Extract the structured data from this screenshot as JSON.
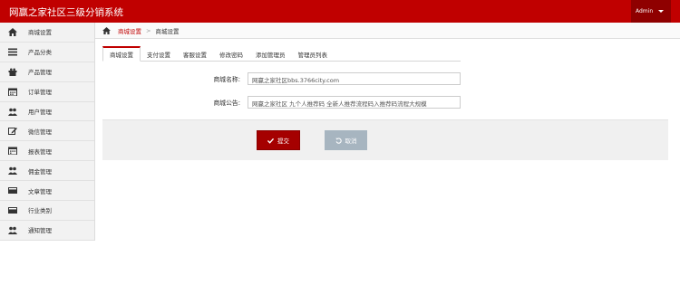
{
  "app": {
    "title": "网赢之家社区三级分销系统",
    "user": "Admin"
  },
  "sidebar": {
    "items": [
      {
        "label": "商城设置",
        "icon": "home-icon"
      },
      {
        "label": "产品分类",
        "icon": "list-icon"
      },
      {
        "label": "产品管理",
        "icon": "gift-icon"
      },
      {
        "label": "订单管理",
        "icon": "calendar-icon"
      },
      {
        "label": "用户管理",
        "icon": "users-icon"
      },
      {
        "label": "微信管理",
        "icon": "edit-icon"
      },
      {
        "label": "报表管理",
        "icon": "calendar-icon"
      },
      {
        "label": "佣金管理",
        "icon": "users-icon"
      },
      {
        "label": "文章管理",
        "icon": "card-icon"
      },
      {
        "label": "行业类别",
        "icon": "card-icon"
      },
      {
        "label": "通知管理",
        "icon": "users-icon"
      }
    ]
  },
  "breadcrumb": {
    "parent": "商城设置",
    "current": "商城设置"
  },
  "tabs": [
    "商城设置",
    "支付设置",
    "客服设置",
    "修改密码",
    "添加管理员",
    "管理员列表"
  ],
  "form": {
    "name_label": "商城名称:",
    "name_value": "网赢之家社区bbs.3766city.com",
    "notice_label": "商城公告:",
    "notice_value": "网赢之家社区 九个人推荐码 全新人推荐流程码入推荐码流程大规模"
  },
  "actions": {
    "submit": "提交",
    "reset": "取消"
  },
  "colors": {
    "brand": "#c00000",
    "submit": "#a50000",
    "reset": "#a7b5c0"
  }
}
